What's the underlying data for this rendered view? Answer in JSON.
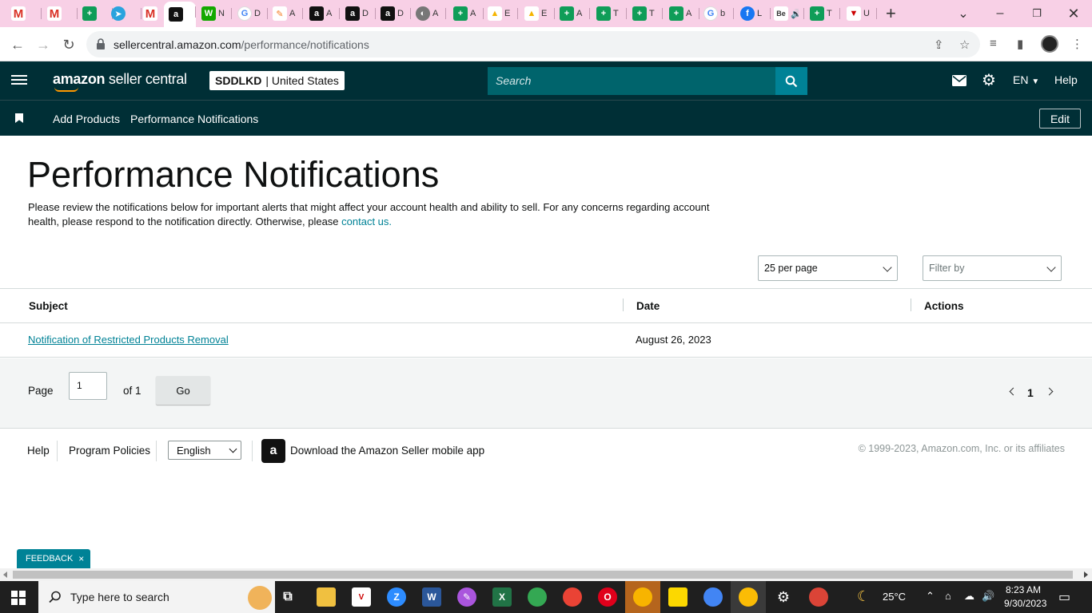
{
  "browser": {
    "tabs": [
      {
        "icon": "gmail-icon",
        "glyph": "M",
        "cls": "ic-gm",
        "title": ""
      },
      {
        "icon": "gmail-icon",
        "glyph": "M",
        "cls": "ic-gm",
        "title": ""
      },
      {
        "icon": "sheets-icon",
        "glyph": "+",
        "cls": "ic-sh",
        "title": ""
      },
      {
        "icon": "telegram-icon",
        "glyph": "➤",
        "cls": "ic-tg",
        "title": ""
      },
      {
        "icon": "gmail-icon",
        "glyph": "M",
        "cls": "ic-gm",
        "title": ""
      },
      {
        "icon": "amazon-icon",
        "glyph": "a",
        "cls": "ic-az",
        "title": "",
        "active": true
      },
      {
        "icon": "upwork-icon",
        "glyph": "W",
        "cls": "ic-up",
        "title": "N"
      },
      {
        "icon": "google-icon",
        "glyph": "G",
        "cls": "ic-go",
        "title": "D"
      },
      {
        "icon": "pencil-icon",
        "glyph": "✎",
        "cls": "ic-pn",
        "title": "A"
      },
      {
        "icon": "amazon-icon",
        "glyph": "a",
        "cls": "ic-az",
        "title": "A"
      },
      {
        "icon": "amazon-icon",
        "glyph": "a",
        "cls": "ic-az",
        "title": "D"
      },
      {
        "icon": "amazon-icon",
        "glyph": "a",
        "cls": "ic-az",
        "title": "D"
      },
      {
        "icon": "globe-icon",
        "glyph": "◐",
        "cls": "ic-gl",
        "title": "A"
      },
      {
        "icon": "sheets-icon",
        "glyph": "+",
        "cls": "ic-sh",
        "title": "A"
      },
      {
        "icon": "drive-icon",
        "glyph": "▲",
        "cls": "ic-dr",
        "title": "E"
      },
      {
        "icon": "drive-icon",
        "glyph": "▲",
        "cls": "ic-dr",
        "title": "E"
      },
      {
        "icon": "sheets-icon",
        "glyph": "+",
        "cls": "ic-sh",
        "title": "A"
      },
      {
        "icon": "sheets-icon",
        "glyph": "+",
        "cls": "ic-sh",
        "title": "T"
      },
      {
        "icon": "sheets-icon",
        "glyph": "+",
        "cls": "ic-sh",
        "title": "T"
      },
      {
        "icon": "sheets-icon",
        "glyph": "+",
        "cls": "ic-sh",
        "title": "A"
      },
      {
        "icon": "google-icon",
        "glyph": "G",
        "cls": "ic-go",
        "title": "b"
      },
      {
        "icon": "facebook-icon",
        "glyph": "f",
        "cls": "ic-fb",
        "title": "L"
      },
      {
        "icon": "behance-icon",
        "glyph": "Be",
        "cls": "ic-be",
        "title": "🔊"
      },
      {
        "icon": "sheets-icon",
        "glyph": "+",
        "cls": "ic-sh",
        "title": "T"
      },
      {
        "icon": "vivaldi-icon",
        "glyph": "▼",
        "cls": "ic-vv",
        "title": "U"
      }
    ],
    "new_tab": "+",
    "url_host": "sellercentral.amazon.com",
    "url_path": "/performance/notifications"
  },
  "header": {
    "logo_bold": "amazon",
    "logo_light": " seller central",
    "account_name": "SDDLKD",
    "account_region": "| United States",
    "search_placeholder": "Search",
    "language": "EN",
    "help": "Help"
  },
  "subnav": {
    "links": [
      "Add Products",
      "Performance Notifications"
    ],
    "edit": "Edit"
  },
  "main": {
    "title": "Performance Notifications",
    "intro": "Please review the notifications below for important alerts that might affect your account health and ability to sell. For any concerns regarding account health, please respond to the notification directly. Otherwise, please ",
    "contact_link": "contact us.",
    "per_page": "25 per page",
    "filter_placeholder": "Filter by"
  },
  "table": {
    "columns": [
      "Subject",
      "Date",
      "Actions"
    ],
    "rows": [
      {
        "subject": "Notification of Restricted Products Removal",
        "date": "August 26, 2023",
        "actions": ""
      }
    ]
  },
  "pager": {
    "page_label": "Page",
    "page_value": "1",
    "of_label": "of 1",
    "go": "Go",
    "current": "1"
  },
  "footer": {
    "help": "Help",
    "policies": "Program Policies",
    "language": "English",
    "app_text": "Download the Amazon Seller mobile app",
    "copyright": "© 1999-2023, Amazon.com, Inc. or its affiliates"
  },
  "feedback": {
    "label": "FEEDBACK",
    "close": "×"
  },
  "taskbar": {
    "search_placeholder": "Type here to search",
    "weather": "25°C",
    "time": "8:23 AM",
    "date": "9/30/2023"
  },
  "colors": {
    "header_bg": "#002f36",
    "link": "#008296",
    "tab_strip": "#f8d0e6"
  }
}
